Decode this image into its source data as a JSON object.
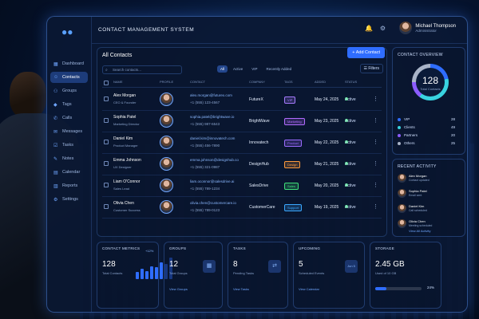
{
  "app": {
    "title": "CONTACT MANAGEMENT SYSTEM"
  },
  "user": {
    "name": "Michael Thompson",
    "role": "Administrator"
  },
  "sidebar": {
    "items": [
      {
        "label": "Dashboard",
        "icon": "grid-icon"
      },
      {
        "label": "Contacts",
        "icon": "contacts-icon",
        "active": true
      },
      {
        "label": "Groups",
        "icon": "groups-icon"
      },
      {
        "label": "Tags",
        "icon": "tag-icon"
      },
      {
        "label": "Calls",
        "icon": "phone-icon"
      },
      {
        "label": "Messages",
        "icon": "message-icon"
      },
      {
        "label": "Tasks",
        "icon": "tasks-icon"
      },
      {
        "label": "Notes",
        "icon": "notes-icon"
      },
      {
        "label": "Calendar",
        "icon": "calendar-icon"
      },
      {
        "label": "Reports",
        "icon": "reports-icon"
      },
      {
        "label": "Settings",
        "icon": "gear-icon"
      }
    ]
  },
  "contacts": {
    "title": "All Contacts",
    "add_label": "+ Add Contact",
    "search_placeholder": "Search contacts...",
    "filters": [
      "All",
      "Active",
      "VIP",
      "Recently Added"
    ],
    "filter_button": "Filters",
    "columns": [
      "NAME",
      "PROFILE",
      "CONTACT",
      "COMPANY",
      "TAGS",
      "ADDED",
      "STATUS"
    ],
    "rows": [
      {
        "name": "Alex Morgan",
        "title": "CEO & Founder",
        "email": "alex.morgan@futurex.com",
        "phone": "+1 (555) 123-4567",
        "company": "FutureX",
        "tag": "VIP",
        "tag_color": "#a77bff",
        "added": "May 24, 2025",
        "status": "Active"
      },
      {
        "name": "Sophia Patel",
        "title": "Marketing Director",
        "email": "sophia.patel@brightwave.io",
        "phone": "+1 (555) 987-6543",
        "company": "BrightWave",
        "tag": "Marketing",
        "tag_color": "#b26bff",
        "added": "May 23, 2025",
        "status": "Active"
      },
      {
        "name": "Daniel Kim",
        "title": "Product Manager",
        "email": "daniel.kim@innovatech.com",
        "phone": "+1 (555) 456-7890",
        "company": "Innovatech",
        "tag": "Product",
        "tag_color": "#9b6bff",
        "added": "May 22, 2025",
        "status": "Active"
      },
      {
        "name": "Emma Johnson",
        "title": "UX Designer",
        "email": "emma.johnson@designhub.co",
        "phone": "+1 (555) 321-0987",
        "company": "DesignHub",
        "tag": "Design",
        "tag_color": "#ff9a3c",
        "added": "May 21, 2025",
        "status": "Active"
      },
      {
        "name": "Liam O'Connor",
        "title": "Sales Lead",
        "email": "liam.oconnor@salesdrive.ai",
        "phone": "+1 (555) 789-1234",
        "company": "SalesDrive",
        "tag": "Sales",
        "tag_color": "#3fe07a",
        "added": "May 20, 2025",
        "status": "Active"
      },
      {
        "name": "Olivia Chen",
        "title": "Customer Success",
        "email": "olivia.chen@customercare.io",
        "phone": "+1 (555) 789-0123",
        "company": "CustomerCare",
        "tag": "Support",
        "tag_color": "#3aa8ff",
        "added": "May 19, 2025",
        "status": "Active"
      }
    ]
  },
  "overview": {
    "title": "CONTACT OVERVIEW",
    "total": "128",
    "total_label": "Total Contacts",
    "legend": [
      {
        "name": "VIP",
        "value": "28",
        "color": "#2f6dff"
      },
      {
        "name": "Clients",
        "value": "49",
        "color": "#39d3e0"
      },
      {
        "name": "Partners",
        "value": "20",
        "color": "#8b5cff"
      },
      {
        "name": "Others",
        "value": "25",
        "color": "#a9b4c8"
      }
    ]
  },
  "activity": {
    "title": "RECENT ACTIVITY",
    "items": [
      {
        "name": "Alex Morgan",
        "desc": "Contact updated"
      },
      {
        "name": "Sophia Patel",
        "desc": "Email sent"
      },
      {
        "name": "Daniel Kim",
        "desc": "Call scheduled"
      },
      {
        "name": "Olivia Chen",
        "desc": "Meeting scheduled"
      }
    ],
    "link": "View All Activity"
  },
  "cards": {
    "metrics": {
      "title": "CONTACT METRICS",
      "value": "128",
      "sub": "Total Contacts",
      "change": "+12%",
      "bars": [
        0.3,
        0.45,
        0.35,
        0.55,
        0.5,
        0.7,
        0.65,
        0.9
      ]
    },
    "groups": {
      "title": "GROUPS",
      "value": "12",
      "sub": "Total Groups",
      "link": "View Groups"
    },
    "tasks": {
      "title": "TASKS",
      "value": "8",
      "sub": "Pending Tasks",
      "link": "View Tasks"
    },
    "upcoming": {
      "title": "UPCOMING",
      "value": "5",
      "sub": "Scheduled Events",
      "link": "View Calendar",
      "icon_label": "Jun 5"
    },
    "storage": {
      "title": "STORAGE",
      "value": "2.45 GB",
      "sub": "Used of 10 GB",
      "percent": "24%",
      "fill": 0.24
    }
  }
}
